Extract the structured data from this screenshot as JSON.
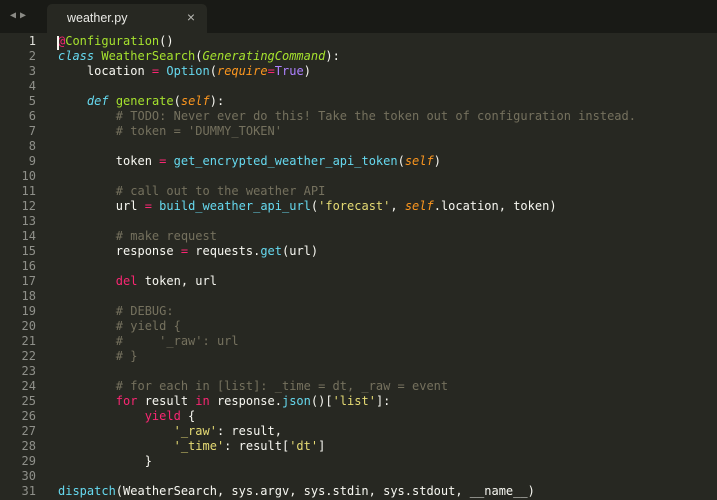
{
  "colors": {
    "background": "#272822",
    "tab_bar": "#191a16",
    "default": "#f8f8f2",
    "keyword": "#f92672",
    "storage": "#66d9ef",
    "class_name": "#a6e22e",
    "function_name": "#a6e22e",
    "string": "#e6db74",
    "comment": "#75715e",
    "constant": "#ae81ff",
    "parameter": "#fd971f",
    "builtin": "#66d9ef",
    "line_number": "#8f908a"
  },
  "tabs": {
    "nav": {
      "back_icon": "◀",
      "forward_icon": "▶"
    },
    "active_tab": {
      "title": "weather.py",
      "close_icon": "×"
    }
  },
  "editor": {
    "active_line": 1,
    "lines": [
      [
        {
          "t": "@",
          "c": "keyword"
        },
        {
          "t": "Configuration",
          "c": "function_name"
        },
        {
          "t": "()",
          "c": "default"
        }
      ],
      [
        {
          "t": "class",
          "c": "storage",
          "i": true
        },
        {
          "t": " ",
          "c": "default"
        },
        {
          "t": "WeatherSearch",
          "c": "class_name"
        },
        {
          "t": "(",
          "c": "default"
        },
        {
          "t": "GeneratingCommand",
          "c": "class_name",
          "i": true
        },
        {
          "t": "):",
          "c": "default"
        }
      ],
      [
        {
          "t": "    location ",
          "c": "default"
        },
        {
          "t": "=",
          "c": "keyword"
        },
        {
          "t": " ",
          "c": "default"
        },
        {
          "t": "Option",
          "c": "builtin"
        },
        {
          "t": "(",
          "c": "default"
        },
        {
          "t": "require",
          "c": "parameter",
          "i": true
        },
        {
          "t": "=",
          "c": "keyword"
        },
        {
          "t": "True",
          "c": "constant"
        },
        {
          "t": ")",
          "c": "default"
        }
      ],
      [],
      [
        {
          "t": "    ",
          "c": "default"
        },
        {
          "t": "def",
          "c": "storage",
          "i": true
        },
        {
          "t": " ",
          "c": "default"
        },
        {
          "t": "generate",
          "c": "function_name"
        },
        {
          "t": "(",
          "c": "default"
        },
        {
          "t": "self",
          "c": "parameter",
          "i": true
        },
        {
          "t": "):",
          "c": "default"
        }
      ],
      [
        {
          "t": "        # TODO: Never ever do this! Take the token out of configuration instead.",
          "c": "comment"
        }
      ],
      [
        {
          "t": "        # token = 'DUMMY_TOKEN'",
          "c": "comment"
        }
      ],
      [],
      [
        {
          "t": "        token ",
          "c": "default"
        },
        {
          "t": "=",
          "c": "keyword"
        },
        {
          "t": " ",
          "c": "default"
        },
        {
          "t": "get_encrypted_weather_api_token",
          "c": "builtin"
        },
        {
          "t": "(",
          "c": "default"
        },
        {
          "t": "self",
          "c": "parameter",
          "i": true
        },
        {
          "t": ")",
          "c": "default"
        }
      ],
      [],
      [
        {
          "t": "        # call out to the weather API",
          "c": "comment"
        }
      ],
      [
        {
          "t": "        url ",
          "c": "default"
        },
        {
          "t": "=",
          "c": "keyword"
        },
        {
          "t": " ",
          "c": "default"
        },
        {
          "t": "build_weather_api_url",
          "c": "builtin"
        },
        {
          "t": "(",
          "c": "default"
        },
        {
          "t": "'forecast'",
          "c": "string"
        },
        {
          "t": ", ",
          "c": "default"
        },
        {
          "t": "self",
          "c": "parameter",
          "i": true
        },
        {
          "t": ".location, token)",
          "c": "default"
        }
      ],
      [],
      [
        {
          "t": "        # make request",
          "c": "comment"
        }
      ],
      [
        {
          "t": "        response ",
          "c": "default"
        },
        {
          "t": "=",
          "c": "keyword"
        },
        {
          "t": " requests.",
          "c": "default"
        },
        {
          "t": "get",
          "c": "builtin"
        },
        {
          "t": "(url)",
          "c": "default"
        }
      ],
      [],
      [
        {
          "t": "        ",
          "c": "default"
        },
        {
          "t": "del",
          "c": "keyword"
        },
        {
          "t": " token, url",
          "c": "default"
        }
      ],
      [],
      [
        {
          "t": "        # DEBUG:",
          "c": "comment"
        }
      ],
      [
        {
          "t": "        # yield {",
          "c": "comment"
        }
      ],
      [
        {
          "t": "        #     '_raw': url",
          "c": "comment"
        }
      ],
      [
        {
          "t": "        # }",
          "c": "comment"
        }
      ],
      [],
      [
        {
          "t": "        # for each in [list]: _time = dt, _raw = event",
          "c": "comment"
        }
      ],
      [
        {
          "t": "        ",
          "c": "default"
        },
        {
          "t": "for",
          "c": "keyword"
        },
        {
          "t": " result ",
          "c": "default"
        },
        {
          "t": "in",
          "c": "keyword"
        },
        {
          "t": " response.",
          "c": "default"
        },
        {
          "t": "json",
          "c": "builtin"
        },
        {
          "t": "()[",
          "c": "default"
        },
        {
          "t": "'list'",
          "c": "string"
        },
        {
          "t": "]:",
          "c": "default"
        }
      ],
      [
        {
          "t": "            ",
          "c": "default"
        },
        {
          "t": "yield",
          "c": "keyword"
        },
        {
          "t": " {",
          "c": "default"
        }
      ],
      [
        {
          "t": "                ",
          "c": "default"
        },
        {
          "t": "'_raw'",
          "c": "string"
        },
        {
          "t": ": result,",
          "c": "default"
        }
      ],
      [
        {
          "t": "                ",
          "c": "default"
        },
        {
          "t": "'_time'",
          "c": "string"
        },
        {
          "t": ": result[",
          "c": "default"
        },
        {
          "t": "'dt'",
          "c": "string"
        },
        {
          "t": "]",
          "c": "default"
        }
      ],
      [
        {
          "t": "            }",
          "c": "default"
        }
      ],
      [],
      [
        {
          "t": "dispatch",
          "c": "builtin"
        },
        {
          "t": "(WeatherSearch, sys.argv, sys.stdin, sys.stdout, __name__)",
          "c": "default"
        }
      ]
    ]
  }
}
